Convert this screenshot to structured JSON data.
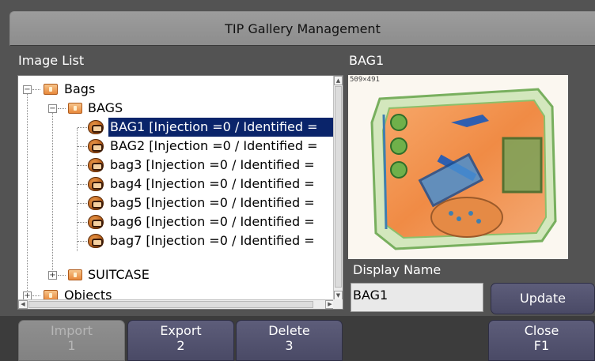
{
  "title": "TIP Gallery Management",
  "image_list": {
    "label": "Image List",
    "items": [
      {
        "label": "Bags",
        "level": 0,
        "expander": "−",
        "icon": "folder-icon"
      },
      {
        "label": "BAGS",
        "level": 1,
        "expander": "−",
        "icon": "folder-icon"
      },
      {
        "label": "BAG1 [Injection =0 / Identified =",
        "level": 2,
        "icon": "bag-image-icon",
        "selected": true
      },
      {
        "label": "BAG2 [Injection =0 / Identified =",
        "level": 2,
        "icon": "bag-image-icon"
      },
      {
        "label": "bag3 [Injection =0 / Identified =",
        "level": 2,
        "icon": "bag-image-icon"
      },
      {
        "label": "bag4 [Injection =0 / Identified =",
        "level": 2,
        "icon": "bag-image-icon"
      },
      {
        "label": "bag5 [Injection =0 / Identified =",
        "level": 2,
        "icon": "bag-image-icon"
      },
      {
        "label": "bag6 [Injection =0 / Identified =",
        "level": 2,
        "icon": "bag-image-icon"
      },
      {
        "label": "bag7 [Injection =0 / Identified =",
        "level": 2,
        "icon": "bag-image-icon"
      },
      {
        "label": "SUITCASE",
        "level": 1,
        "expander": "+",
        "icon": "folder-icon"
      },
      {
        "label": "Objects",
        "level": 0,
        "expander": "+",
        "icon": "folder-icon"
      }
    ]
  },
  "preview": {
    "label": "BAG1",
    "dimensions": "509×491"
  },
  "display_name": {
    "label": "Display Name",
    "value": "BAG1"
  },
  "buttons": {
    "update": "Update",
    "import": {
      "label": "Import",
      "key": "1"
    },
    "export": {
      "label": "Export",
      "key": "2"
    },
    "delete": {
      "label": "Delete",
      "key": "3"
    },
    "close": {
      "label": "Close",
      "key": "F1"
    }
  },
  "colors": {
    "selection": "#0a246a",
    "button": "#4f4f6c",
    "disabled_button": "#888888"
  }
}
